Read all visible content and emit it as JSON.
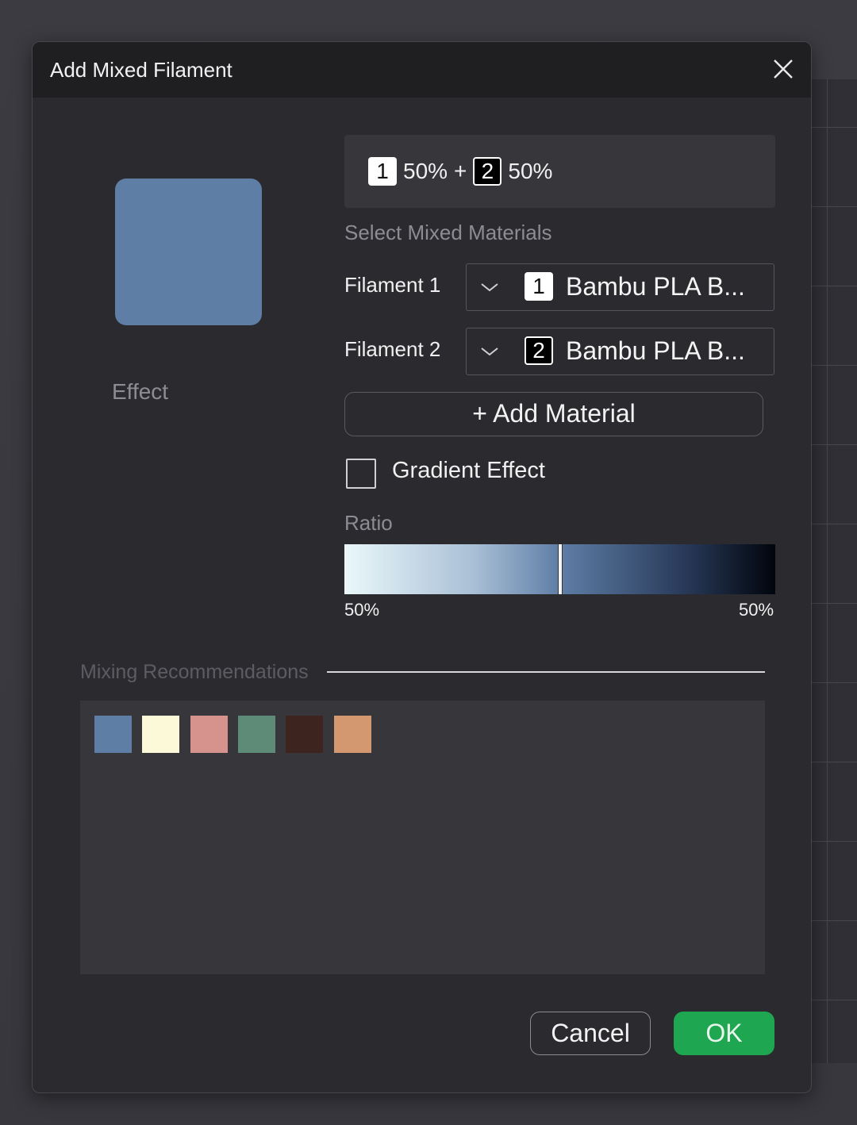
{
  "dialog": {
    "title": "Add Mixed Filament",
    "close_icon": "close-icon"
  },
  "preview": {
    "color": "#5f7ea6",
    "effect_label": "Effect"
  },
  "formula": {
    "badge1": "1",
    "pct1": "50%",
    "plus": "+",
    "badge2": "2",
    "pct2": "50%"
  },
  "materials": {
    "section_label": "Select Mixed Materials",
    "filament1": {
      "label": "Filament 1",
      "badge": "1",
      "value": "Bambu PLA B..."
    },
    "filament2": {
      "label": "Filament 2",
      "badge": "2",
      "value": "Bambu PLA B..."
    },
    "add_material_label": "+ Add Material"
  },
  "gradient": {
    "checked": false,
    "label": "Gradient Effect"
  },
  "ratio": {
    "label": "Ratio",
    "left_value": "50%",
    "right_value": "50%",
    "position": 0.5
  },
  "recommendations": {
    "label": "Mixing Recommendations",
    "swatches": [
      "#5f7ea6",
      "#fbf9d8",
      "#d6938d",
      "#5e8a78",
      "#3e241e",
      "#d39870"
    ]
  },
  "buttons": {
    "cancel": "Cancel",
    "ok": "OK"
  },
  "colors": {
    "ok_green": "#1fa650",
    "dialog_bg": "#2b2b2f",
    "titlebar_bg": "#1f1f22"
  }
}
